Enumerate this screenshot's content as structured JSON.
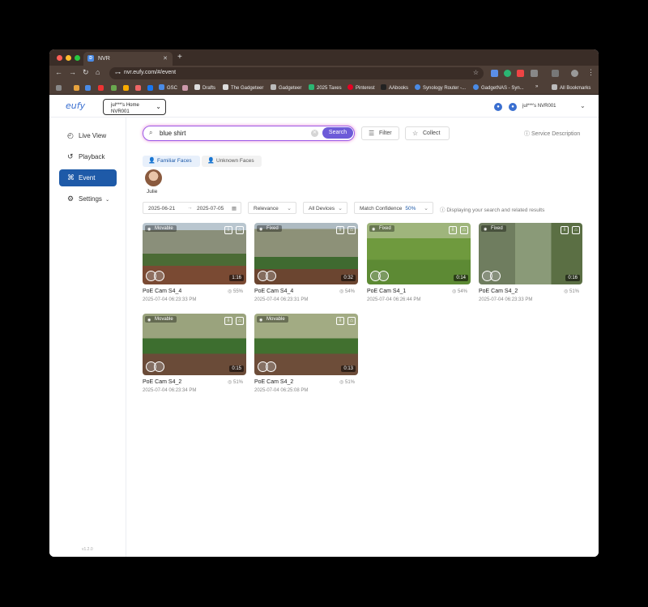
{
  "browser": {
    "tab_title": "NVR",
    "tab_favicon": "D",
    "url": "nvr.eufy.com/#/event",
    "bookmarks": [
      "GSC",
      "Drafts",
      "The Gadgeteer",
      "Gadgeteer",
      "2025 Taxes",
      "Pinterest",
      "AAbooks",
      "Synology Router -...",
      "GadgetNAS - Syn...",
      "All Bookmarks"
    ]
  },
  "header": {
    "logo": "eufy",
    "home_name": "jul***'s Home",
    "home_device": "NVR001",
    "user": "jul***'s NVR001"
  },
  "sidebar": {
    "items": [
      {
        "label": "Live View",
        "icon": "clock-icon"
      },
      {
        "label": "Playback",
        "icon": "playback-icon"
      },
      {
        "label": "Event",
        "icon": "event-icon"
      },
      {
        "label": "Settings",
        "icon": "gear-icon"
      }
    ],
    "version": "v1.2.0"
  },
  "search": {
    "value": "blue shirt",
    "button": "Search",
    "filter_label": "Filter",
    "collect_label": "Collect",
    "service_description": "Service Description"
  },
  "faces": {
    "familiar_tab": "Familiar Faces",
    "unknown_tab": "Unknown Faces",
    "person_name": "Julie"
  },
  "filters": {
    "date_start": "2025-06-21",
    "date_end": "2025-07-05",
    "sort": "Relevance",
    "devices": "All Devices",
    "match_confidence_label": "Match Confidence",
    "match_confidence_value": "50%",
    "displaying_note": "Displaying your search and related results"
  },
  "events": [
    {
      "mode": "Movable",
      "duration": "1:16",
      "camera": "PoE Cam S4_4",
      "confidence": "55%",
      "time": "2025-07-04 06:23:33 PM"
    },
    {
      "mode": "Fixed",
      "duration": "0:32",
      "camera": "PoE Cam S4_4",
      "confidence": "54%",
      "time": "2025-07-04 06:23:31 PM"
    },
    {
      "mode": "Fixed",
      "duration": "0:14",
      "camera": "PoE Cam S4_1",
      "confidence": "54%",
      "time": "2025-07-04 06:26:44 PM"
    },
    {
      "mode": "Fixed",
      "duration": "0:16",
      "camera": "PoE Cam S4_2",
      "confidence": "51%",
      "time": "2025-07-04 06:23:33 PM"
    },
    {
      "mode": "Movable",
      "duration": "0:15",
      "camera": "PoE Cam S4_2",
      "confidence": "51%",
      "time": "2025-07-04 06:23:34 PM"
    },
    {
      "mode": "Movable",
      "duration": "0:13",
      "camera": "PoE Cam S4_2",
      "confidence": "51%",
      "time": "2025-07-04 06:25:08 PM"
    }
  ],
  "colors": {
    "accent": "#1e5aa8",
    "search_button": "#6d5bd8",
    "search_glow": "#9c5ae6"
  }
}
